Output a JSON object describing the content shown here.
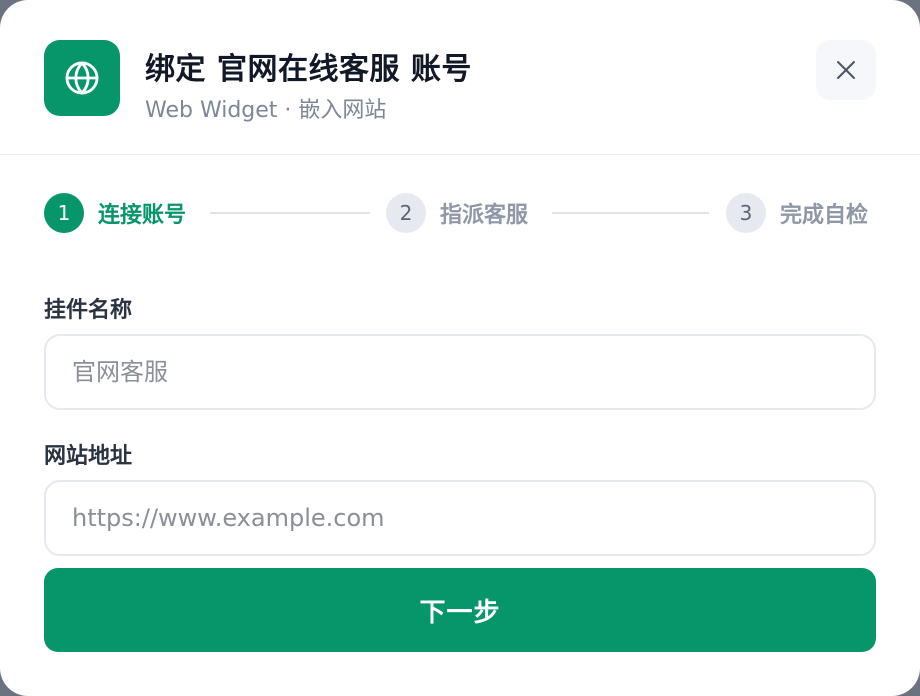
{
  "header": {
    "title": "绑定 官网在线客服 账号",
    "subtitle": "Web Widget · 嵌入网站",
    "app_icon": "globe-icon",
    "close_icon": "close-icon"
  },
  "steps": [
    {
      "number": "1",
      "label": "连接账号",
      "state": "active"
    },
    {
      "number": "2",
      "label": "指派客服",
      "state": "inactive"
    },
    {
      "number": "3",
      "label": "完成自检",
      "state": "inactive"
    }
  ],
  "form": {
    "widget_name": {
      "label": "挂件名称",
      "value": "",
      "placeholder": "官网客服"
    },
    "site_url": {
      "label": "网站地址",
      "value": "",
      "placeholder": "https://www.example.com"
    }
  },
  "actions": {
    "next_label": "下一步"
  },
  "colors": {
    "accent": "#07956a",
    "step_inactive_bg": "#e6eaf0"
  }
}
